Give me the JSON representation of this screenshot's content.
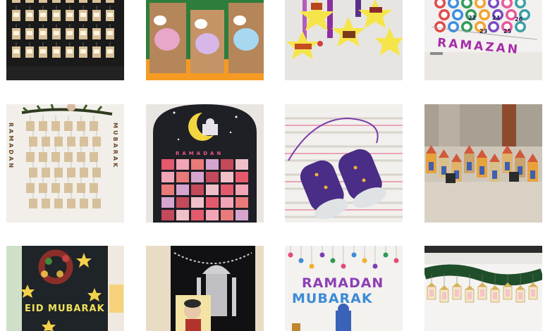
{
  "grid": {
    "tiles": [
      {
        "name": "hanging-advent-bags-photo"
      },
      {
        "name": "paper-bag-characters-photo"
      },
      {
        "name": "paper-stars-candy-photo"
      },
      {
        "name": "felt-ramazan-calendar-photo",
        "text": "RAMAZAN",
        "numbers": [
          "22",
          "24",
          "26",
          "23",
          "25"
        ]
      },
      {
        "name": "branch-ramadan-calendar-photo",
        "text_left": "RAMADAN",
        "text_right": "MUBARAK"
      },
      {
        "name": "mosque-door-calendar-photo",
        "text": "RAMADAN"
      },
      {
        "name": "paper-roll-binoculars-photo"
      },
      {
        "name": "mosque-houses-photo"
      },
      {
        "name": "eid-mubarak-board-photo",
        "text": "EID MUBARAK"
      },
      {
        "name": "mosque-curtain-photo"
      },
      {
        "name": "ramadan-mubarak-letters-photo",
        "line1": "RAMADAN",
        "line2": "MUBARAK"
      },
      {
        "name": "garland-lanterns-photo"
      }
    ]
  }
}
